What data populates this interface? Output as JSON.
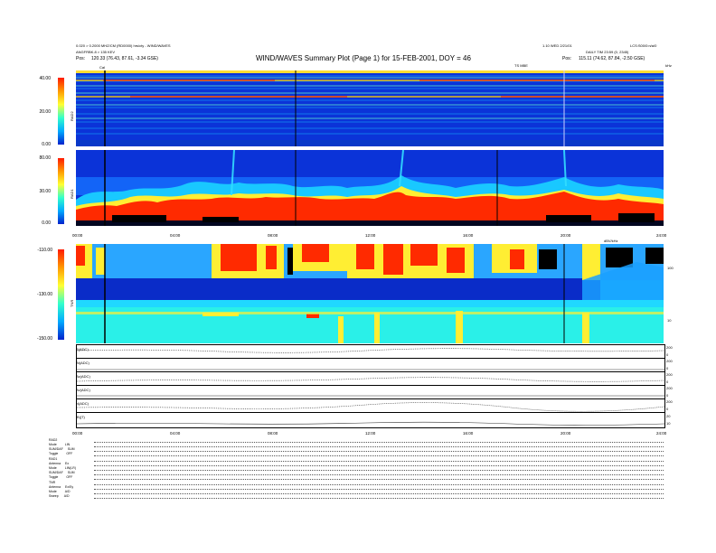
{
  "header": {
    "left_line1": "0.020 > 0.2000 MHZ/CM (RD0000) hrs/cty - WIND/WAVES",
    "left_line2": "ANGFRBK.8 > 135 KEV",
    "left_line3_prefix": "Pos:",
    "left_line3": "120.33 (76.43, 87.61, -3.34 GSE)",
    "title": "WIND/WAVES Summary Plot (Page 1) for 15-FEB-2001, DOY = 46",
    "right_line1a": "1.10 WED 2/21/01",
    "right_line1b": "LCS:S00/0:n/a/0",
    "right_line2": "DAILY TIM 23:59 (0, 2345)",
    "right_line3_prefix": "Pos:",
    "right_line3": "115.11 (74.62, 87.84, -2.50 GSE)",
    "ts_label": "TS MBE",
    "khz_label": "kHz",
    "cal_label": "Cal"
  },
  "panels": {
    "rad2": {
      "label": "RAD2",
      "yticks": [
        "40.00",
        "20.00",
        "0.00"
      ],
      "ylim": [
        0,
        40
      ]
    },
    "rad1": {
      "label": "RAD1",
      "yticks": [
        "80.00",
        "30.00",
        "0.00"
      ],
      "ylim": [
        0,
        80
      ]
    },
    "tnr": {
      "label": "TNR",
      "yticks": [
        "-110.00",
        "-130.00",
        "-150.00"
      ],
      "ylim": [
        -150,
        -110
      ],
      "right_ticks": [
        "100",
        "10"
      ],
      "right_label": "dBV/kHz"
    },
    "xticks": [
      "00:00",
      "04:00",
      "08:00",
      "12:00",
      "16:00",
      "20:00",
      "24:00"
    ],
    "line_labels": [
      "B(ADC)",
      "Bt(ADC)",
      "Bz(ADC)",
      "Bv(ADC)",
      "N(ADC)",
      "|B|(T)"
    ],
    "line_right_ticks": [
      [
        "200",
        "0"
      ],
      [
        "200",
        "0"
      ],
      [
        "200",
        "0"
      ],
      [
        "200",
        "0"
      ],
      [
        "200",
        "0"
      ],
      [
        "20",
        "10"
      ]
    ]
  },
  "footer": {
    "rows": [
      {
        "k": "RAD2",
        "v": ""
      },
      {
        "k": "Mode",
        "v": "LIN"
      },
      {
        "k": "SUM/DAF",
        "v": "SUM"
      },
      {
        "k": "Toggle",
        "v": "OFF"
      },
      {
        "k": "RAD1",
        "v": ""
      },
      {
        "k": "Antenna",
        "v": "Ex"
      },
      {
        "k": "Mode",
        "v": "LIN(LR)"
      },
      {
        "k": "SUM/DAF",
        "v": "SUM"
      },
      {
        "k": "Toggle",
        "v": "OFF"
      },
      {
        "k": "TNR",
        "v": ""
      },
      {
        "k": "Antenna",
        "v": "Ex/Ey"
      },
      {
        "k": "Mode",
        "v": "A/D"
      },
      {
        "k": "Sweep",
        "v": "A/D"
      }
    ]
  },
  "chart_data": {
    "type": "heatmap",
    "title": "WIND/WAVES Summary Plot (Page 1) for 15-FEB-2001, DOY = 46",
    "x_range": [
      "00:00",
      "24:00"
    ],
    "panels": [
      {
        "name": "RAD2",
        "ylim": [
          0,
          40
        ]
      },
      {
        "name": "RAD1",
        "ylim": [
          0,
          80
        ]
      },
      {
        "name": "TNR",
        "ylim": [
          -150,
          -110
        ]
      }
    ],
    "colors": {
      "low": "#0b33d8",
      "mid": "#18c8ff",
      "high": "#ff2a00"
    }
  }
}
